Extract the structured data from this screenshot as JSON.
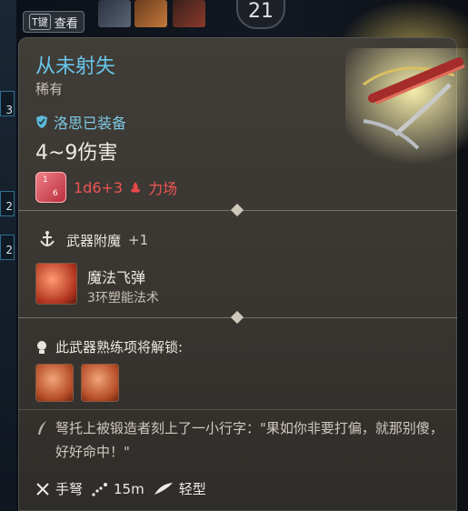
{
  "topbar": {
    "key_label": "T键",
    "view_label": "查看",
    "level": "21"
  },
  "left_slots": [
    "3",
    "2",
    "2"
  ],
  "item": {
    "name": "从未射失",
    "rarity": "稀有",
    "equipped_by": "洛思已装备",
    "damage": "4~9伤害",
    "damage_dice": "1d6+3",
    "damage_type": "力场",
    "dice_face_a": "1",
    "dice_face_b": "6"
  },
  "enchant": {
    "title": "武器附魔",
    "bonus": "+1",
    "spell_name": "魔法飞弹",
    "spell_detail": "3环塑能法术"
  },
  "proficiency": {
    "title": "此武器熟练项将解锁:"
  },
  "flavor": {
    "text": "弩托上被锻造者刻上了一小行字：\"果如你非要打偏，就那别傻，好好命中！\""
  },
  "footer": {
    "weapon_type": "手弩",
    "range": "15m",
    "weight_class": "轻型"
  },
  "icons": {
    "equipped": "shield-check-icon",
    "enchant": "anchor-star-icon",
    "proficiency": "lightbulb-icon",
    "flavor": "quill-icon",
    "weapon_type": "crossed-bolts-icon",
    "range": "dotted-arc-icon",
    "weight": "feather-icon"
  },
  "colors": {
    "title": "#67c6ea",
    "equipped": "#7dc9e4",
    "damage": "#ef5454",
    "panel": "#3b3833"
  }
}
